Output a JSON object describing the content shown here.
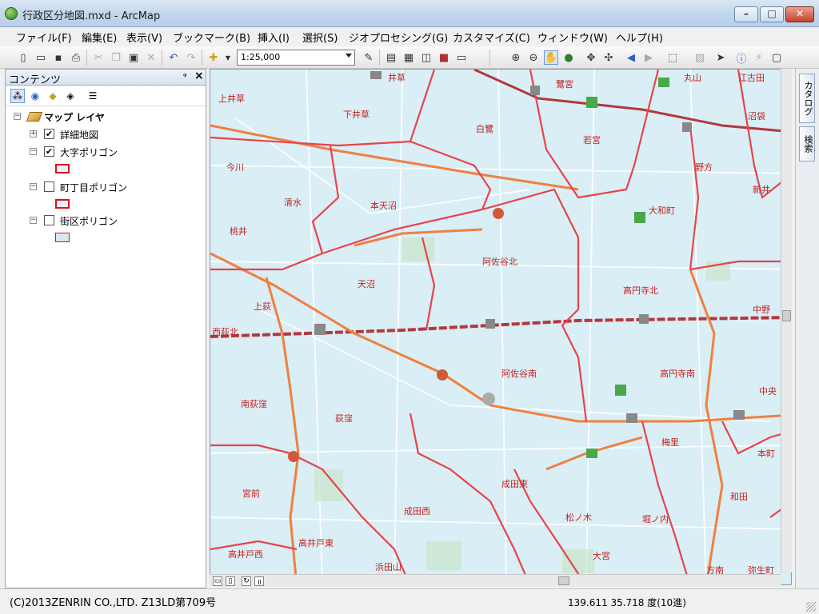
{
  "window": {
    "title": "行政区分地図.mxd - ArcMap",
    "min_label": "–",
    "max_label": "□",
    "close_label": "✕"
  },
  "menu": [
    "ファイル(F)",
    "編集(E)",
    "表示(V)",
    "ブックマーク(B)",
    "挿入(I)",
    "選択(S)",
    "ジオプロセシング(G)",
    "カスタマイズ(C)",
    "ウィンドウ(W)",
    "ヘルプ(H)"
  ],
  "toolbar": {
    "scale_value": "1:25,000"
  },
  "toc": {
    "title": "コンテンツ",
    "pin": "ᵠ",
    "close": "×",
    "root_label": "マップ レイヤ",
    "layers": [
      {
        "label": "詳細地図",
        "checked": true,
        "expander": "+"
      },
      {
        "label": "大字ポリゴン",
        "checked": true,
        "expander": "−"
      },
      {
        "label": "町丁目ポリゴン",
        "checked": false,
        "expander": "−"
      },
      {
        "label": "街区ポリゴン",
        "checked": false,
        "expander": "−"
      }
    ]
  },
  "dock": {
    "catalog": "カタログ",
    "search": "検索"
  },
  "map": {
    "labels": [
      "井草",
      "鷺宮",
      "丸山",
      "江古田",
      "上井草",
      "下井草",
      "白鷺",
      "沼袋",
      "若宮",
      "今川",
      "野方",
      "清水",
      "本天沼",
      "大和町",
      "新井",
      "桃井",
      "阿佐谷北",
      "天沼",
      "高円寺北",
      "上荻",
      "中野",
      "西荻北",
      "阿佐谷南",
      "高円寺南",
      "中央",
      "南荻窪",
      "荻窪",
      "梅里",
      "本町",
      "宮前",
      "成田東",
      "和田",
      "成田西",
      "松ノ木",
      "堀ノ内",
      "高井戸東",
      "高井戸西",
      "大宮",
      "浜田山",
      "方南",
      "弥生町"
    ],
    "colors": {
      "water": "#d9eef5",
      "boundary": "#e8434c",
      "road": "#f08040",
      "label": "#c71f1f"
    }
  },
  "status": {
    "copyright": "(C)2013ZENRIN CO.,LTD. Z13LD第709号",
    "coords": "139.611  35.718 度(10進)"
  }
}
